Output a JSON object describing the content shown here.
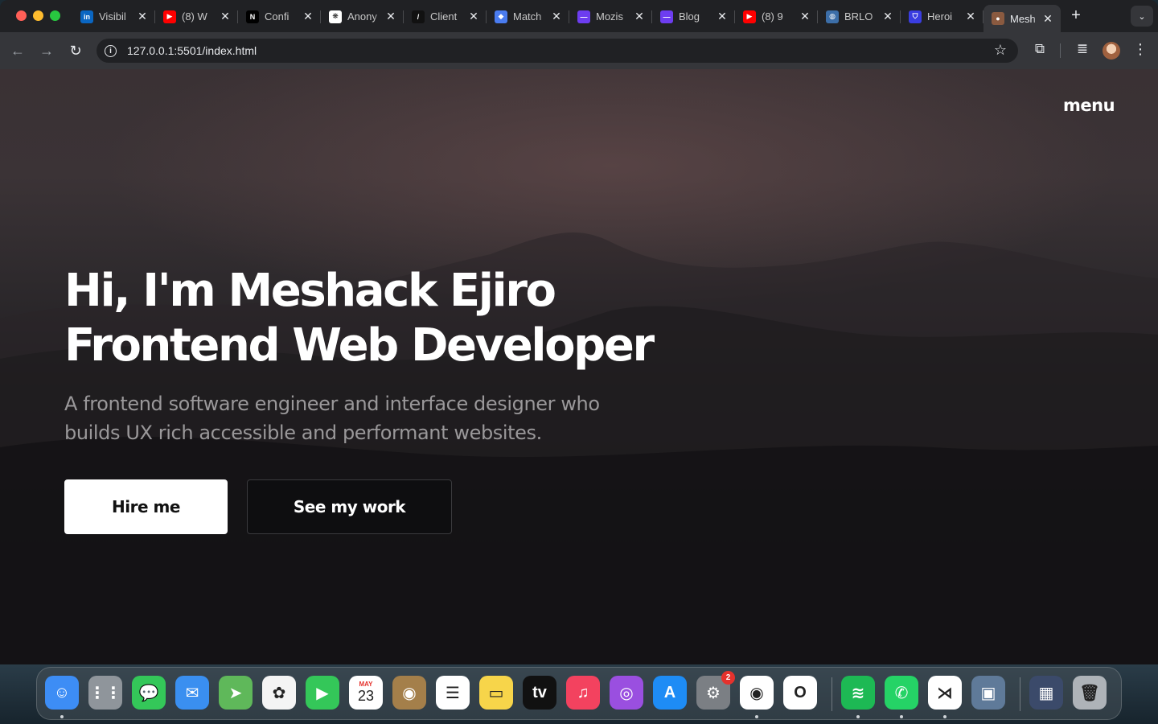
{
  "browser": {
    "tabs": [
      {
        "title": "Visibil",
        "favicon": "linkedin-icon",
        "color": "#0a66c2",
        "glyph": "in"
      },
      {
        "title": "(8) W",
        "favicon": "youtube-icon",
        "color": "#ff0000",
        "glyph": "▶"
      },
      {
        "title": "Confi",
        "favicon": "n-logo-icon",
        "color": "#000000",
        "glyph": "N"
      },
      {
        "title": "Anony",
        "favicon": "openai-icon",
        "color": "#ffffff",
        "glyph": "❋"
      },
      {
        "title": "Client",
        "favicon": "slash-icon",
        "color": "#111111",
        "glyph": "/"
      },
      {
        "title": "Match",
        "favicon": "diamond-icon",
        "color": "#4a7cf0",
        "glyph": "◆"
      },
      {
        "title": "Mozis",
        "favicon": "mozis-icon",
        "color": "#6d3df0",
        "glyph": "—"
      },
      {
        "title": "Blog",
        "favicon": "mozis-icon",
        "color": "#6d3df0",
        "glyph": "—"
      },
      {
        "title": "(8) 9",
        "favicon": "youtube-icon",
        "color": "#ff0000",
        "glyph": "▶"
      },
      {
        "title": "BRLO",
        "favicon": "globe-icon",
        "color": "#3c6ea8",
        "glyph": "◍"
      },
      {
        "title": "Heroi",
        "favicon": "shield-icon",
        "color": "#3a3de0",
        "glyph": "⛉"
      },
      {
        "title": "Mesh",
        "favicon": "avatar-icon",
        "color": "#8a5a40",
        "glyph": "●",
        "active": true
      }
    ],
    "close_glyph": "✕",
    "new_tab_glyph": "+",
    "tab_search_glyph": "⌄",
    "nav": {
      "back": "←",
      "forward": "→",
      "reload": "↻",
      "menu": "⋮"
    },
    "url": "127.0.0.1:5501/index.html",
    "info_glyph": "i",
    "star_glyph": "☆",
    "extensions_glyph": "⧉",
    "media_glyph": "≣"
  },
  "page": {
    "menu_label": "menu",
    "hero_line1": "Hi, I'm Meshack Ejiro",
    "hero_line2": "Frontend Web Developer",
    "hero_sub": "A frontend software engineer and interface designer who builds UX rich accessible and performant websites.",
    "hire_label": "Hire me",
    "work_label": "See my work"
  },
  "dock": {
    "apps": [
      {
        "name": "finder-icon",
        "bg": "#3d8df5",
        "glyph": "☺",
        "dot": true
      },
      {
        "name": "launchpad-icon",
        "bg": "#8f959b",
        "glyph": "⋮⋮"
      },
      {
        "name": "messages-icon",
        "bg": "#34c759",
        "glyph": "💬"
      },
      {
        "name": "mail-icon",
        "bg": "#3a8ff0",
        "glyph": "✉"
      },
      {
        "name": "maps-icon",
        "bg": "#5fb85a",
        "glyph": "➤"
      },
      {
        "name": "photos-icon",
        "bg": "#f4f4f4",
        "glyph": "✿"
      },
      {
        "name": "facetime-icon",
        "bg": "#34c759",
        "glyph": "▶"
      },
      {
        "name": "calendar-icon",
        "bg": "#ffffff",
        "glyph": "23",
        "label": "MAY"
      },
      {
        "name": "contacts-icon",
        "bg": "#a47f4a",
        "glyph": "◉"
      },
      {
        "name": "reminders-icon",
        "bg": "#ffffff",
        "glyph": "☰"
      },
      {
        "name": "notes-icon",
        "bg": "#f7d54a",
        "glyph": "▭"
      },
      {
        "name": "appletv-icon",
        "bg": "#111111",
        "glyph": "tv"
      },
      {
        "name": "music-icon",
        "bg": "#f3425f",
        "glyph": "♫"
      },
      {
        "name": "podcasts-icon",
        "bg": "#9a4fe0",
        "glyph": "◎"
      },
      {
        "name": "appstore-icon",
        "bg": "#1e8cf5",
        "glyph": "A"
      },
      {
        "name": "system-settings-icon",
        "bg": "#7b7f84",
        "glyph": "⚙",
        "badge": "2"
      },
      {
        "name": "chrome-icon",
        "bg": "#ffffff",
        "glyph": "◉",
        "dot": true
      },
      {
        "name": "opera-icon",
        "bg": "#ffffff",
        "glyph": "O"
      },
      {
        "name": "spotify-icon",
        "bg": "#1db954",
        "glyph": "≋",
        "dot": true
      },
      {
        "name": "whatsapp-icon",
        "bg": "#25d366",
        "glyph": "✆",
        "dot": true
      },
      {
        "name": "vscode-icon",
        "bg": "#ffffff",
        "glyph": "⋊",
        "dot": true
      },
      {
        "name": "preview-icon",
        "bg": "#5f7a99",
        "glyph": "▣"
      },
      {
        "name": "screenshot-stack-icon",
        "bg": "#3b4a6a",
        "glyph": "▦"
      },
      {
        "name": "trash-icon",
        "bg": "#aeb3b8",
        "glyph": "🗑"
      }
    ]
  }
}
